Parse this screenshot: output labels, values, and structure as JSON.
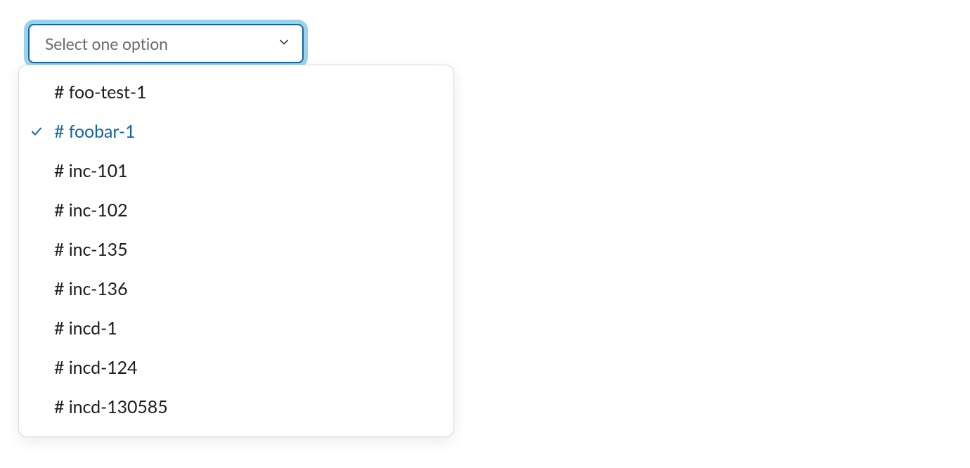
{
  "select": {
    "placeholder": "Select one option",
    "selected_index": 1,
    "options": [
      {
        "label": "# foo-test-1"
      },
      {
        "label": "# foobar-1"
      },
      {
        "label": "# inc-101"
      },
      {
        "label": "# inc-102"
      },
      {
        "label": "# inc-135"
      },
      {
        "label": "# inc-136"
      },
      {
        "label": "# incd-1"
      },
      {
        "label": "# incd-124"
      },
      {
        "label": "# incd-130585"
      }
    ]
  },
  "colors": {
    "accent": "#1264a3",
    "focus_ring": "#9ad2ec"
  }
}
